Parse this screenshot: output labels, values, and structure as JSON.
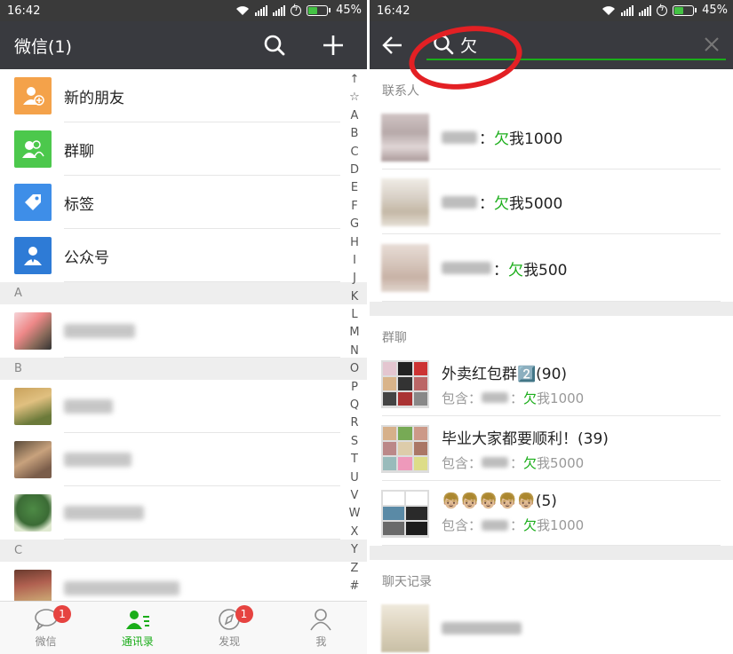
{
  "left": {
    "status": {
      "time": "16:42",
      "battery": "45%"
    },
    "header": {
      "title": "微信(1)"
    },
    "fixed_items": [
      {
        "label": "新的朋友",
        "color": "#f4a24a",
        "icon": "add-friend-icon"
      },
      {
        "label": "群聊",
        "color": "#4cc84c",
        "icon": "group-chat-icon"
      },
      {
        "label": "标签",
        "color": "#3e8ee8",
        "icon": "tag-icon"
      },
      {
        "label": "公众号",
        "color": "#2e7bd6",
        "icon": "official-account-icon"
      }
    ],
    "sections": [
      {
        "letter": "A"
      },
      {
        "letter": "B"
      },
      {
        "letter": "C"
      }
    ],
    "index_letters": [
      "↑",
      "☆",
      "A",
      "B",
      "C",
      "D",
      "E",
      "F",
      "G",
      "H",
      "I",
      "J",
      "K",
      "L",
      "M",
      "N",
      "O",
      "P",
      "Q",
      "R",
      "S",
      "T",
      "U",
      "V",
      "W",
      "X",
      "Y",
      "Z",
      "#"
    ],
    "tabs": [
      {
        "label": "微信",
        "badge": "1",
        "active": false,
        "icon": "chat-bubble-icon"
      },
      {
        "label": "通讯录",
        "badge": "",
        "active": true,
        "icon": "contacts-icon"
      },
      {
        "label": "发现",
        "badge": "1",
        "active": false,
        "icon": "compass-icon"
      },
      {
        "label": "我",
        "badge": "",
        "active": false,
        "icon": "person-icon"
      }
    ]
  },
  "right": {
    "status": {
      "time": "16:42",
      "battery": "45%"
    },
    "search": {
      "query": "欠"
    },
    "section_contacts": "联系人",
    "contacts": [
      {
        "separator": "：",
        "highlight": "欠",
        "rest": "我1000"
      },
      {
        "separator": "：",
        "highlight": "欠",
        "rest": "我5000"
      },
      {
        "separator": "：",
        "highlight": "欠",
        "rest": "我500"
      }
    ],
    "section_groups": "群聊",
    "groups": [
      {
        "name": "外卖红包群2️⃣(90)",
        "sub_prefix": "包含：",
        "sub_sep": "：",
        "highlight": "欠",
        "rest": "我1000"
      },
      {
        "name": "毕业大家都要顺利！(39)",
        "sub_prefix": "包含：",
        "sub_sep": "：",
        "highlight": "欠",
        "rest": "我5000"
      },
      {
        "name": "👦🏼👦🏼👦🏼👦🏼👦🏼(5)",
        "sub_prefix": "包含：",
        "sub_sep": "：",
        "highlight": "欠",
        "rest": "我1000"
      }
    ],
    "section_history": "聊天记录"
  }
}
